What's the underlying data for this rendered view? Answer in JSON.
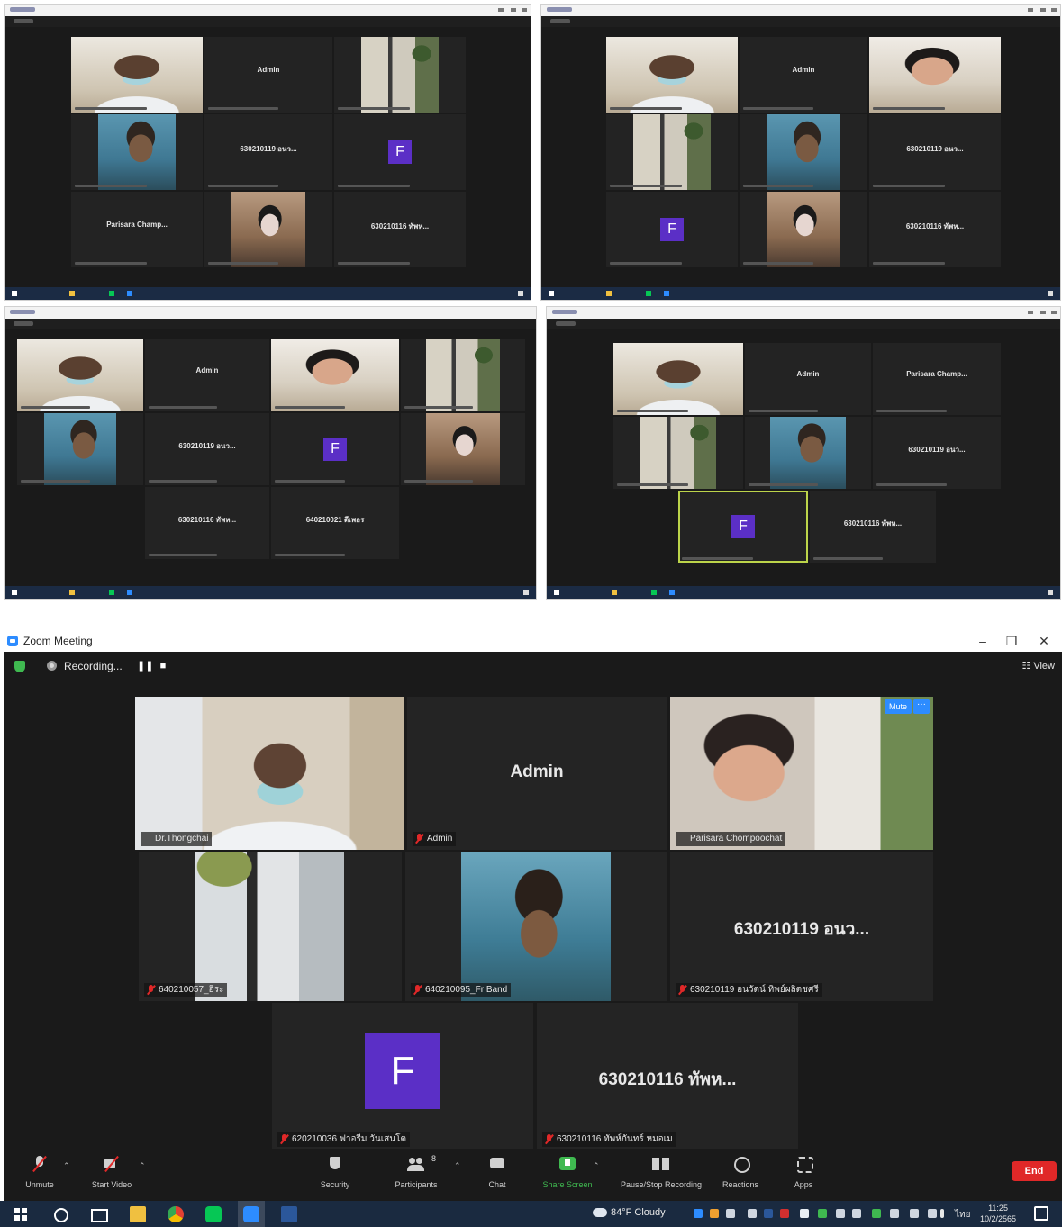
{
  "thumbnails": {
    "admin_name": "Admin",
    "name_630210119": "630210119 อนว...",
    "name_630210116": "630210116 ทัพห...",
    "name_parisara": "Parisara Champ...",
    "name_640210021": "640210021 ดีเพอร",
    "avatar_letter": "F"
  },
  "window": {
    "title": "Zoom Meeting",
    "minimize": "–",
    "maximize": "❐",
    "close": "✕"
  },
  "topbar": {
    "recording_label": "Recording...",
    "pause_symbol": "❚❚",
    "stop_symbol": "■",
    "view_label": "☷ View"
  },
  "tiles": [
    {
      "label": "Dr.Thongchai",
      "display": ""
    },
    {
      "label": "Admin",
      "display": "Admin"
    },
    {
      "label": "Parisara Chompoochat",
      "display": "",
      "mute_btn": "Mute",
      "more_btn": "···"
    },
    {
      "label": "640210057_อิระ",
      "display": ""
    },
    {
      "label": "640210095_Fr Band",
      "display": ""
    },
    {
      "label": "630210119 อนวัตน์ ทิพย์ผลิตชศรี",
      "display": "630210119 อนว..."
    },
    {
      "label": "620210036 ฟาอรีม วันเสนโต",
      "display": "",
      "avatar": "F"
    },
    {
      "label": "630210116 ทัพห์กันทร์ หมอเม",
      "display": "630210116 ทัพห..."
    }
  ],
  "toolbar": {
    "unmute": "Unmute",
    "start_video": "Start Video",
    "security": "Security",
    "participants": "Participants",
    "participants_count": "8",
    "chat": "Chat",
    "share_screen": "Share Screen",
    "recording": "Pause/Stop Recording",
    "reactions": "Reactions",
    "apps": "Apps",
    "end": "End",
    "caret": "⌃"
  },
  "taskbar": {
    "weather": "84°F  Cloudy",
    "language": "ไทย",
    "time": "11:25",
    "date": "10/2/2565"
  },
  "colors": {
    "zoom_blue": "#2d8cff",
    "avatar_purple": "#5b2fc6",
    "speaker_outline": "#c9e24a",
    "end_red": "#e02828",
    "share_green": "#3fb950"
  }
}
